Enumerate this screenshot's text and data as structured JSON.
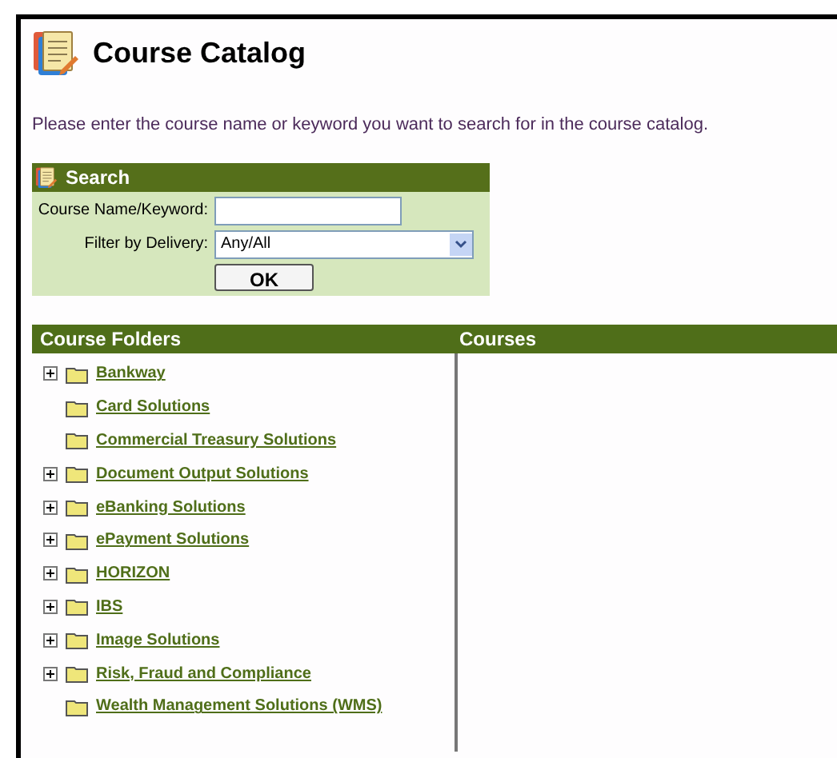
{
  "title": "Course Catalog",
  "instructions": "Please enter the course name or keyword you want to search for in the course catalog.",
  "search": {
    "title": "Search",
    "keyword_label": "Course Name/Keyword:",
    "delivery_label": "Filter by Delivery:",
    "delivery_value": "Any/All",
    "button": "OK"
  },
  "table": {
    "columns": [
      "Course Folders",
      "Courses"
    ],
    "folders": [
      {
        "label": "Bankway",
        "expandable": true
      },
      {
        "label": "Card Solutions",
        "expandable": false
      },
      {
        "label": "Commercial Treasury Solutions",
        "expandable": false
      },
      {
        "label": "Document Output Solutions",
        "expandable": true
      },
      {
        "label": "eBanking Solutions",
        "expandable": true
      },
      {
        "label": "ePayment Solutions",
        "expandable": true
      },
      {
        "label": "HORIZON",
        "expandable": true
      },
      {
        "label": "IBS",
        "expandable": true
      },
      {
        "label": "Image Solutions",
        "expandable": true
      },
      {
        "label": "Risk, Fraud and Compliance",
        "expandable": true
      },
      {
        "label": "Wealth Management Solutions (WMS)",
        "expandable": false
      }
    ]
  }
}
